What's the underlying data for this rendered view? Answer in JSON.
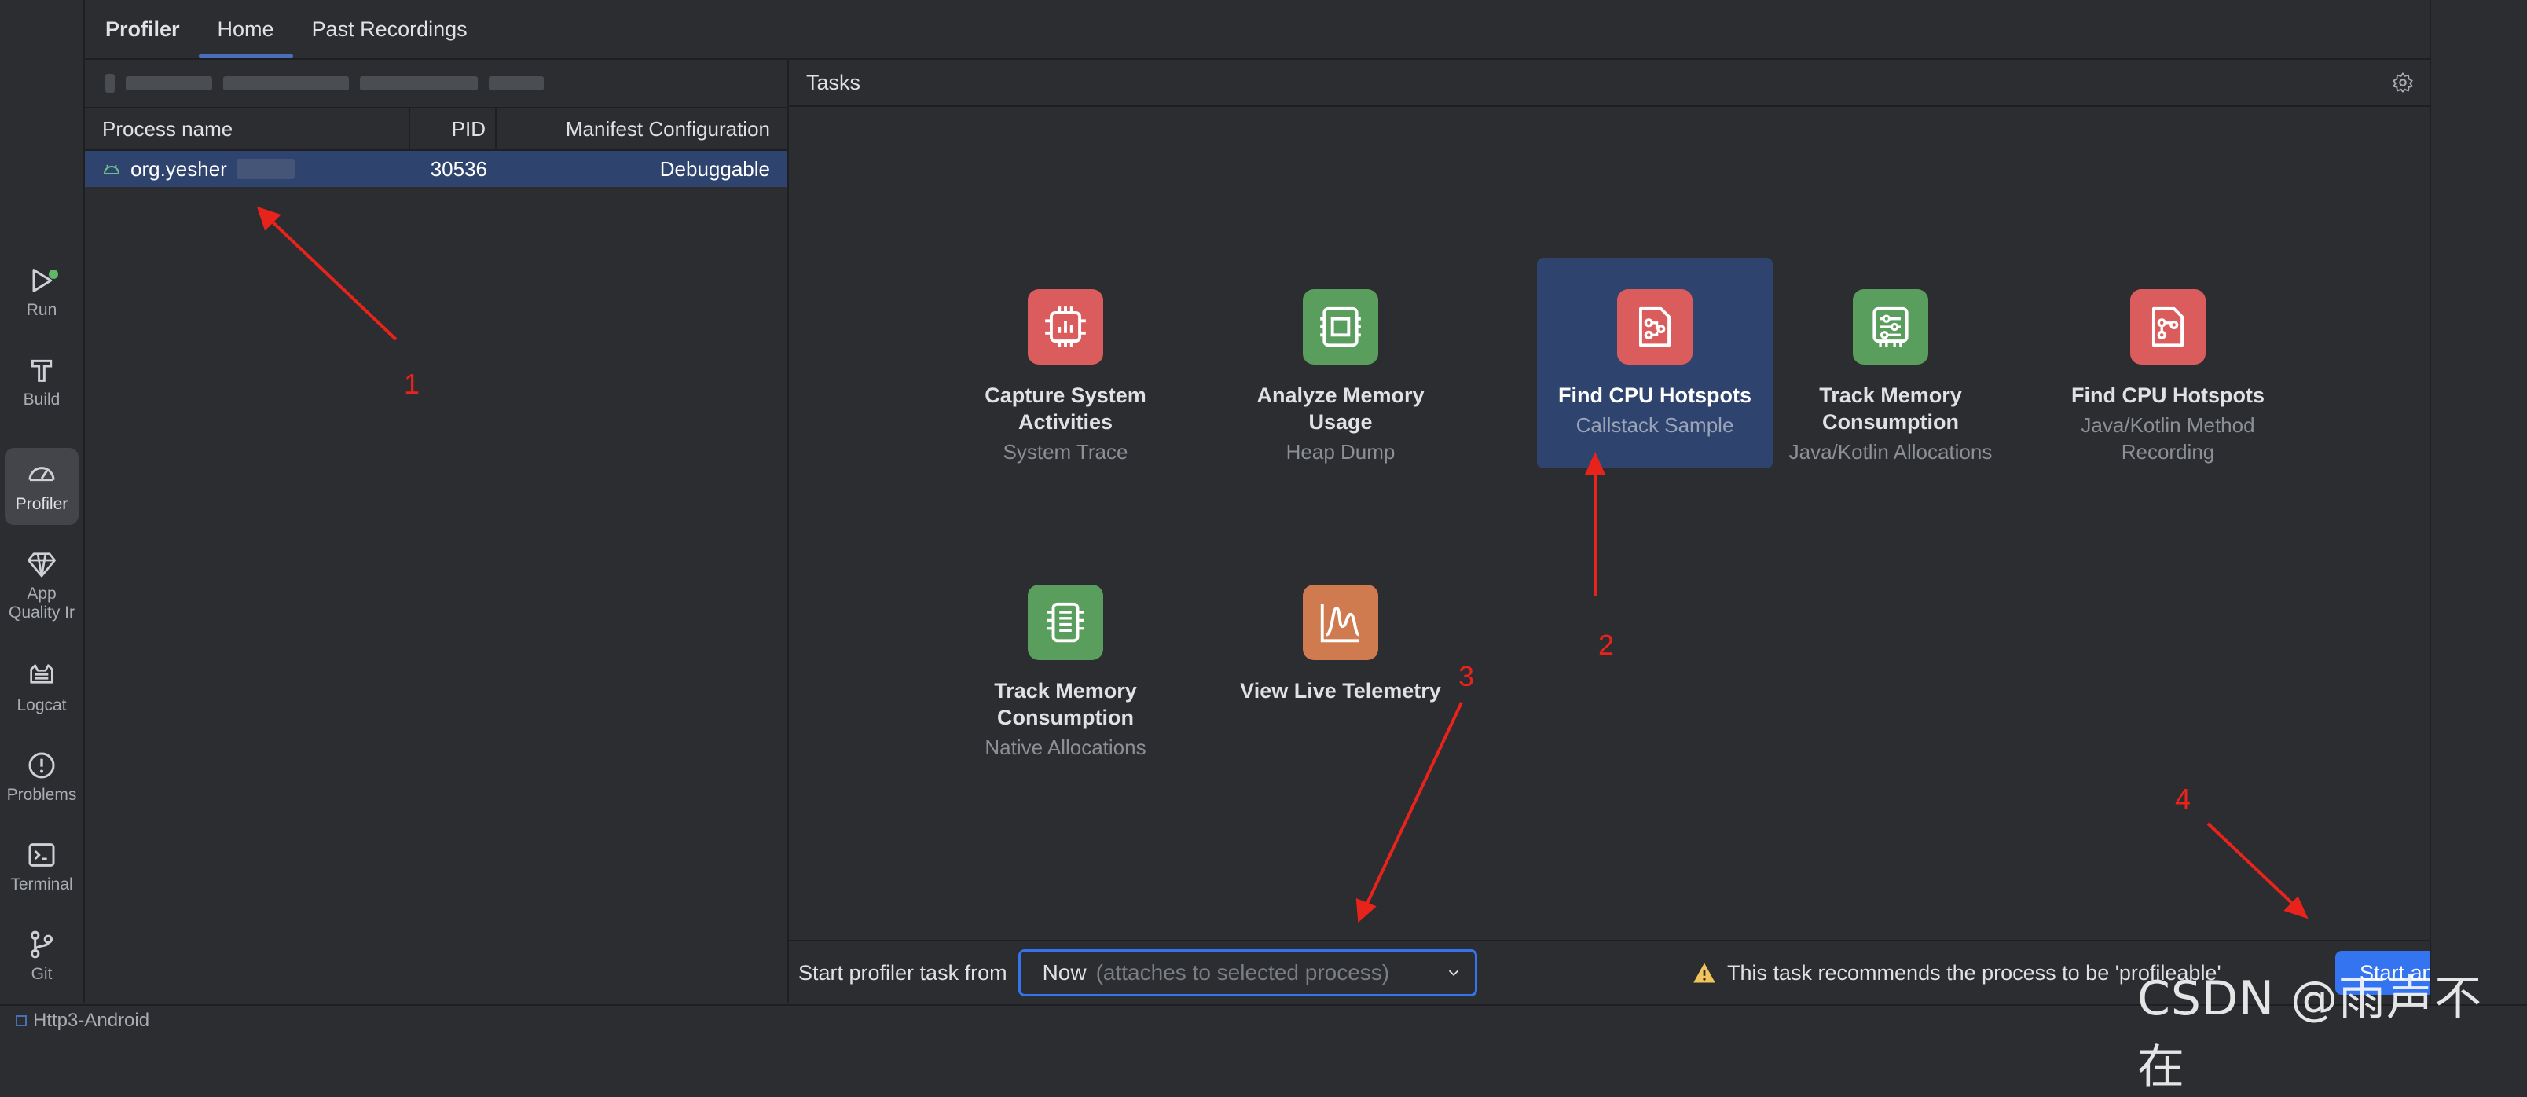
{
  "tool_window_bar": [
    {
      "label": "Run",
      "icon": "run-icon"
    },
    {
      "label": "Build",
      "icon": "hammer-icon"
    },
    {
      "label": "Profiler",
      "icon": "gauge-icon",
      "active": true
    },
    {
      "label": "App\nQuality Ir",
      "icon": "diamond-icon"
    },
    {
      "label": "Logcat",
      "icon": "cat-icon"
    },
    {
      "label": "Problems",
      "icon": "alert-circle-icon"
    },
    {
      "label": "Terminal",
      "icon": "terminal-icon"
    },
    {
      "label": "Git",
      "icon": "branch-icon"
    }
  ],
  "tabs": {
    "title": "Profiler",
    "home": "Home",
    "past": "Past Recordings"
  },
  "process_table": {
    "headers": {
      "name": "Process name",
      "pid": "PID",
      "manifest": "Manifest Configuration"
    },
    "rows": [
      {
        "name": "org.yesher",
        "pid": "30536",
        "manifest": "Debuggable"
      }
    ]
  },
  "tasks_panel": {
    "header": "Tasks",
    "tasks": [
      {
        "title": "Capture System Activities",
        "subtitle": "System Trace",
        "color": "#db5c5c",
        "icon": "cpu-bars-icon"
      },
      {
        "title": "Analyze Memory Usage",
        "subtitle": "Heap Dump",
        "color": "#5a9e5e",
        "icon": "memory-chip-icon"
      },
      {
        "title": "Find CPU Hotspots",
        "subtitle": "Callstack Sample",
        "color": "#db5c5c",
        "icon": "callstack-doc-icon",
        "selected": true
      },
      {
        "title": "Track Memory Consumption",
        "subtitle": "Java/Kotlin Allocations",
        "color": "#5a9e5e",
        "icon": "memory-sliders-icon"
      },
      {
        "title": "Find CPU Hotspots",
        "subtitle": "Java/Kotlin Method Recording",
        "color": "#db5c5c",
        "icon": "method-doc-icon"
      },
      {
        "title": "Track Memory Consumption",
        "subtitle": "Native Allocations",
        "color": "#5a9e5e",
        "icon": "native-memory-icon"
      },
      {
        "title": "View Live Telemetry",
        "subtitle": "",
        "color": "#cf7b4f",
        "icon": "telemetry-chart-icon"
      }
    ]
  },
  "bottom_bar": {
    "start_label": "Start profiler task from",
    "dropdown_value": "Now",
    "dropdown_hint": "(attaches to selected process)",
    "warning": "This task recommends the process to be 'profileable'",
    "start_button": "Start anyway"
  },
  "status_bar": {
    "project": "Http3-Android"
  },
  "annotations": [
    "1",
    "2",
    "3",
    "4"
  ],
  "watermark": "CSDN @雨声不在"
}
